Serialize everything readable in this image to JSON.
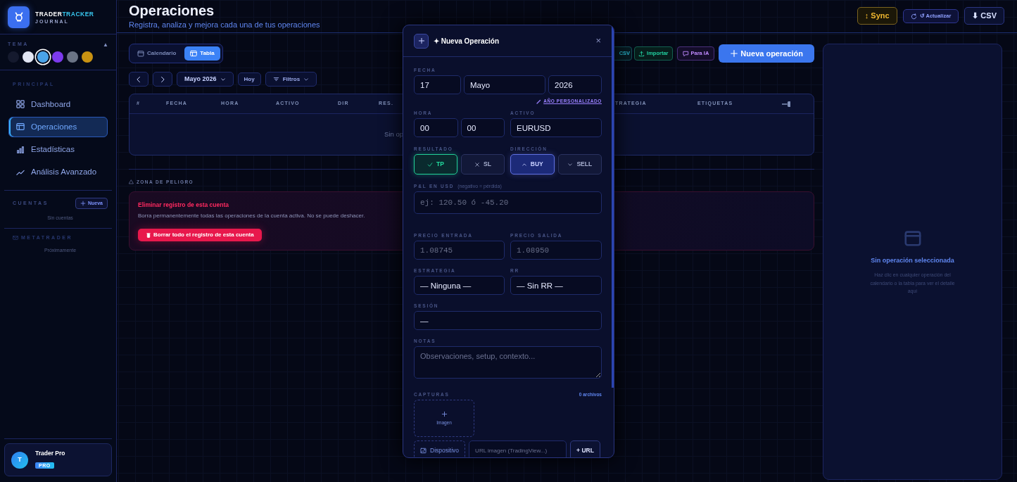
{
  "brand": {
    "name_a": "TRADER",
    "name_b": "TRACKER",
    "sub": "JOURNAL"
  },
  "theme": {
    "label": "TEMA",
    "toggle": "▲",
    "swatches": [
      {
        "color": "#151a2e",
        "selected": false
      },
      {
        "color": "#e2e6f3",
        "selected": false
      },
      {
        "color": "#4aa3e8",
        "selected": true
      },
      {
        "color": "#7c3aed",
        "selected": false
      },
      {
        "color": "#6b7486",
        "selected": false
      },
      {
        "color": "#c99212",
        "selected": false
      }
    ]
  },
  "sidebar": {
    "section": "PRINCIPAL",
    "items": [
      {
        "label": "Dashboard",
        "kind": "grid",
        "selected": false
      },
      {
        "label": "Operaciones",
        "kind": "table",
        "selected": true
      },
      {
        "label": "Estadísticas",
        "kind": "bars",
        "selected": false
      },
      {
        "label": "Análisis Avanzado",
        "kind": "trend",
        "selected": false
      }
    ]
  },
  "accounts": {
    "title": "CUENTAS",
    "button": "Nueva",
    "empty": "Sin cuentas"
  },
  "metatrader": {
    "title": "METATRADER",
    "note": "Próximamente"
  },
  "user": {
    "initial": "T",
    "name": "Trader Pro",
    "badge": "PRO"
  },
  "header": {
    "title": "Operaciones",
    "subtitle": "Registra, analiza y mejora cada una de tus operaciones",
    "actions": [
      {
        "label": "↕ Sync",
        "kind": "sync"
      },
      {
        "label": "↺ Actualizar",
        "kind": "refresh"
      },
      {
        "label": "⬇ CSV",
        "kind": "csv"
      }
    ]
  },
  "view_toggle": [
    {
      "label": "Calendario",
      "kind": "calendar",
      "selected": false
    },
    {
      "label": "Tabla",
      "kind": "table",
      "selected": true
    }
  ],
  "toolbar_actions": [
    {
      "label": "CSV",
      "kind": "csv"
    },
    {
      "label": "Importar",
      "kind": "import"
    },
    {
      "label": "Para IA",
      "kind": "ai"
    },
    {
      "label": "Nueva operación",
      "kind": "primary"
    }
  ],
  "nav": {
    "month": "Mayo 2026",
    "today": "Hoy",
    "filters": "Filtros"
  },
  "table": {
    "columns_left": [
      "#",
      "FECHA",
      "HORA",
      "ACTIVO",
      "DIR",
      "RES."
    ],
    "columns_right": [
      "TRATEGIA",
      "ETIQUETAS"
    ],
    "empty": "Sin op"
  },
  "danger": {
    "label": "ZONA DE PELIGRO",
    "title": "Eliminar registro de esta cuenta",
    "text": "Borra permanentemente todas las operaciones de la cuenta activa. No se puede deshacer.",
    "button": "Borrar todo el registro de esta cuenta"
  },
  "modal": {
    "title": "✦ Nueva Operación",
    "close": "×",
    "date": {
      "label": "FECHA",
      "day": "17",
      "month": "Mayo",
      "year": "2026",
      "custom": "AÑO PERSONALIZADO"
    },
    "time": {
      "label": "HORA",
      "hour": "00",
      "minute": "00"
    },
    "asset": {
      "label": "ACTIVO",
      "value": "EURUSD"
    },
    "result": {
      "label": "RESULTADO",
      "options": [
        {
          "label": "TP",
          "kind": "tp",
          "selected": true
        },
        {
          "label": "SL",
          "kind": "sl",
          "selected": false
        }
      ]
    },
    "direction": {
      "label": "DIRECCIÓN",
      "options": [
        {
          "label": "BUY",
          "kind": "buy",
          "selected": true
        },
        {
          "label": "SELL",
          "kind": "sell",
          "selected": false
        }
      ]
    },
    "pnl": {
      "label": "P&L EN USD",
      "hint": "(negativo = pérdida)",
      "placeholder": "ej: 120.50 ó -45.20"
    },
    "entry": {
      "label": "PRECIO ENTRADA",
      "placeholder": "1.08745"
    },
    "exit": {
      "label": "PRECIO SALIDA",
      "placeholder": "1.08950"
    },
    "strategy": {
      "label": "ESTRATEGIA",
      "value": "— Ninguna —"
    },
    "rr": {
      "label": "RR",
      "value": "— Sin RR —"
    },
    "session": {
      "label": "SESIÓN",
      "value": "—"
    },
    "notes": {
      "label": "NOTAS",
      "placeholder": "Observaciones, setup, contexto..."
    },
    "captures": {
      "label": "CAPTURAS",
      "count": "0 archivos",
      "drop": "Imagen",
      "device": "Dispositivo",
      "url_placeholder": "URL imagen (TradingView...)",
      "url_button": "+ URL"
    }
  },
  "detail": {
    "title": "Sin operación seleccionada",
    "text": "Haz clic en cualquier operación del calendario o la tabla para ver el detalle aquí"
  }
}
